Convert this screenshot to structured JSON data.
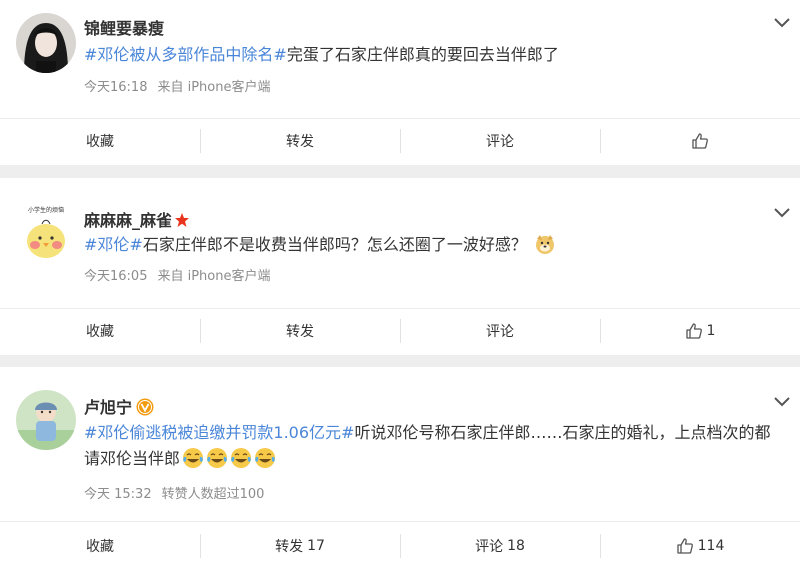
{
  "posts": [
    {
      "username": "锦鲤要暴瘦",
      "tag": "#邓伦被从多部作品中除名#",
      "text": "完蛋了石家庄伴郎真的要回去当伴郎了",
      "time": "今天16:18",
      "source": "来自 iPhone客户端",
      "actions": {
        "collect": "收藏",
        "repost": "转发",
        "comment": "评论",
        "like_count": ""
      }
    },
    {
      "username": "麻麻麻_麻雀",
      "avatar_caption": "小学生的烦恼",
      "tag": "#邓伦#",
      "text": "石家庄伴郎不是收费当伴郎吗？怎么还圈了一波好感？",
      "time": "今天16:05",
      "source": "来自 iPhone客户端",
      "actions": {
        "collect": "收藏",
        "repost": "转发",
        "comment": "评论",
        "like_count": "1"
      }
    },
    {
      "username": "卢旭宁",
      "tag": "#邓伦偷逃税被追缴并罚款1.06亿元#",
      "text": "听说邓伦号称石家庄伴郎……石家庄的婚礼，上点档次的都请邓伦当伴郎",
      "time": "今天 15:32",
      "source": "转赞人数超过100",
      "actions": {
        "collect": "收藏",
        "repost": "转发",
        "repost_count": "17",
        "comment": "评论",
        "comment_count": "18",
        "like_count": "114"
      }
    }
  ],
  "icons": {
    "menu": "chevron-down-icon",
    "like": "thumbs-up-icon",
    "verified": "verified-badge-icon",
    "star": "star-icon",
    "emoji_dog": "doge-emoji",
    "emoji_laugh": "laugh-cry-emoji"
  },
  "colors": {
    "tag": "#4a86d8",
    "meta": "#8c8c8c",
    "verified": "#f39c12",
    "star": "#e8341c"
  }
}
